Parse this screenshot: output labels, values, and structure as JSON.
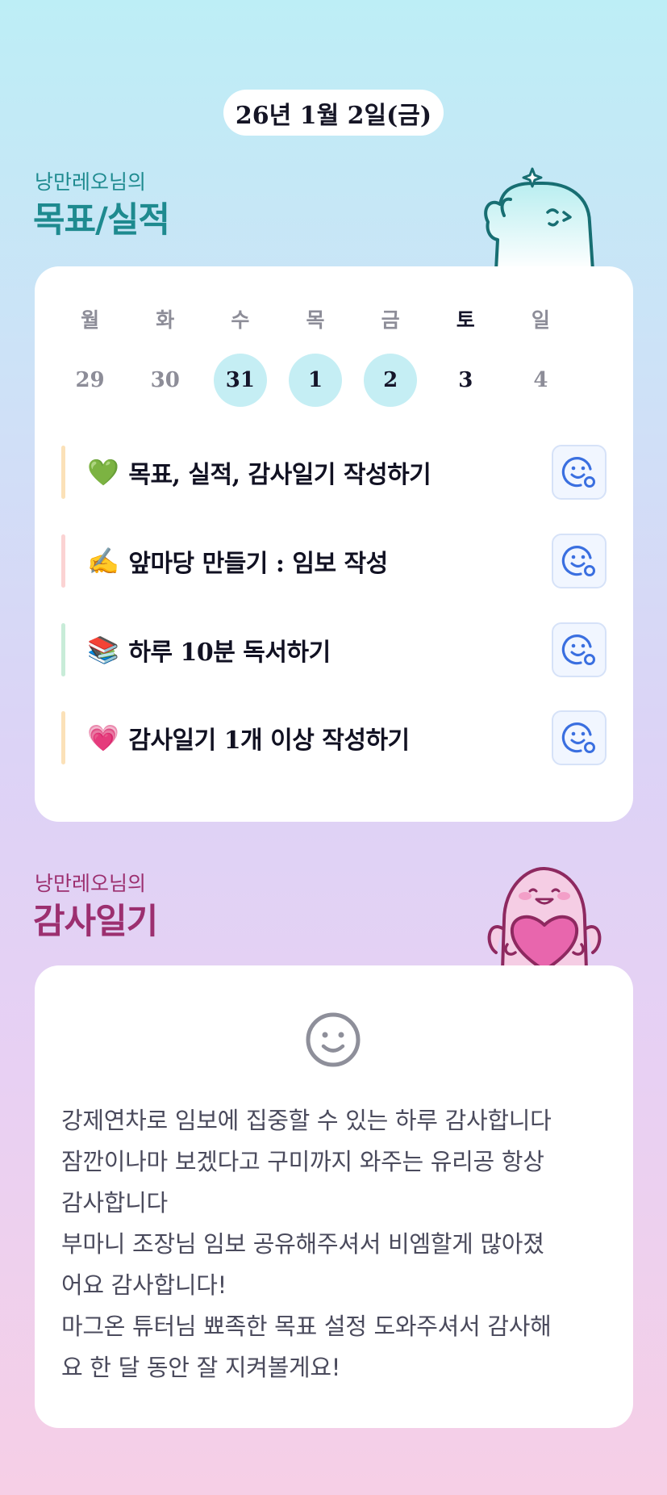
{
  "header": {
    "date": "26년 1월 2일(금)"
  },
  "goals_section": {
    "subtitle": "낭만레오님의",
    "title": "목표/실적",
    "week_days": [
      {
        "label": "월",
        "highlight": false
      },
      {
        "label": "화",
        "highlight": false
      },
      {
        "label": "수",
        "highlight": false
      },
      {
        "label": "목",
        "highlight": false
      },
      {
        "label": "금",
        "highlight": false
      },
      {
        "label": "토",
        "highlight": true
      },
      {
        "label": "일",
        "highlight": false
      }
    ],
    "dates": [
      {
        "num": "29",
        "done": false
      },
      {
        "num": "30",
        "done": false
      },
      {
        "num": "31",
        "done": true
      },
      {
        "num": "1",
        "done": true
      },
      {
        "num": "2",
        "done": true
      },
      {
        "num": "3",
        "done": false
      },
      {
        "num": "4",
        "done": false
      }
    ],
    "goals": [
      {
        "emoji": "💚",
        "text": "목표, 실적, 감사일기 작성하기",
        "bar_color": "#fbe1b8",
        "icon": "smile-plus-icon"
      },
      {
        "emoji": "✍️",
        "text": "앞마당 만들기 : 임보 작성",
        "bar_color": "#fbd3d3",
        "icon": "smile-plus-icon"
      },
      {
        "emoji": "📚",
        "text": "하루 10분 독서하기",
        "bar_color": "#c8ecd8",
        "icon": "smile-plus-icon"
      },
      {
        "emoji": "💗",
        "text": "감사일기 1개 이상 작성하기",
        "bar_color": "#fbe1b8",
        "icon": "smile-plus-icon"
      }
    ]
  },
  "diary_section": {
    "subtitle": "낭만레오님의",
    "title": "감사일기",
    "icon": "smile-icon",
    "entry": "강제연차로 임보에 집중할 수 있는 하루 감사합니다\n잠깐이나마 보겠다고 구미까지 와주는 유리공 항상\n감사합니다\n부마니 조장님 임보 공유해주셔서 비엠할게 많아졌\n어요 감사합니다!\n마그온 튜터님 뾰족한 목표 설정 도와주셔서 감사해\n요 한 달 동안 잘 지켜볼게요!"
  },
  "colors": {
    "accent_teal": "#1e8a8f",
    "accent_plum": "#9c2f6f",
    "done_circle": "#c5eef4",
    "react_icon": "#3a6fe0"
  }
}
